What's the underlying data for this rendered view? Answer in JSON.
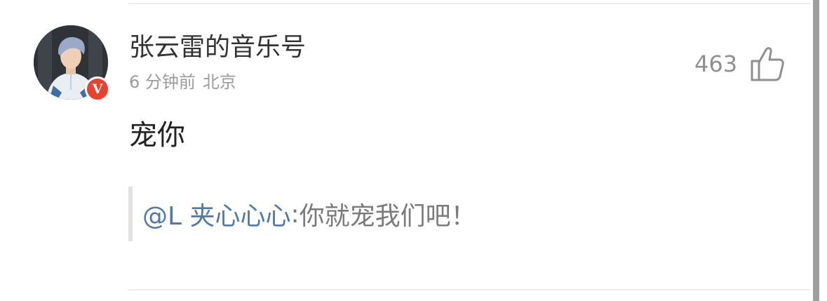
{
  "comment": {
    "author": "张云雷的音乐号",
    "time": "6 分钟前",
    "location": "北京",
    "likes": "463",
    "text": "宠你",
    "badge": "V",
    "quote": {
      "mention": "@L 夹心心心",
      "separator": ": ",
      "text": "你就宠我们吧！"
    }
  },
  "colors": {
    "mention": "#4f7aa8",
    "badge": "#e8412f"
  },
  "icons": {
    "like": "thumbs-up-icon",
    "verified": "verified-badge-icon"
  }
}
